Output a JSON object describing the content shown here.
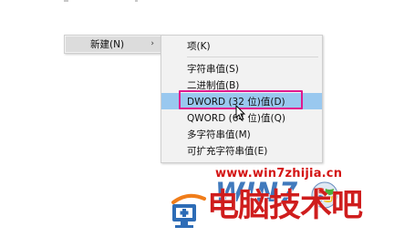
{
  "context_menu": {
    "parent_item": {
      "label": "新建(N)",
      "arrow": "›"
    },
    "submenu_items": [
      {
        "label": "项(K)"
      },
      {
        "label": "字符串值(S)"
      },
      {
        "label": "二进制值(B)"
      },
      {
        "label": "DWORD (32 位)值(D)",
        "highlighted": true
      },
      {
        "label": "QWORD (64 位)值(Q)"
      },
      {
        "label": "多字符串值(M)"
      },
      {
        "label": "可扩充字符串值(E)"
      }
    ]
  },
  "watermark": {
    "website": "www.win7zhijia.cn",
    "win_letters": "WIN7",
    "brand_text": "电脑技术吧"
  },
  "colors": {
    "menu_bg": "#f2f2f2",
    "hover_bg": "#99c8ef",
    "highlight_border": "#e0198e",
    "website_red": "#d41515",
    "logo_red": "#cf1d1d",
    "logo_blue": "#2d6cb6"
  },
  "icons": {
    "submenu_arrow": "chevron-right-icon",
    "cursor": "mouse-pointer-icon",
    "logo_computer": "computer-plus-icon",
    "logo_windows": "windows-flag-icon"
  }
}
